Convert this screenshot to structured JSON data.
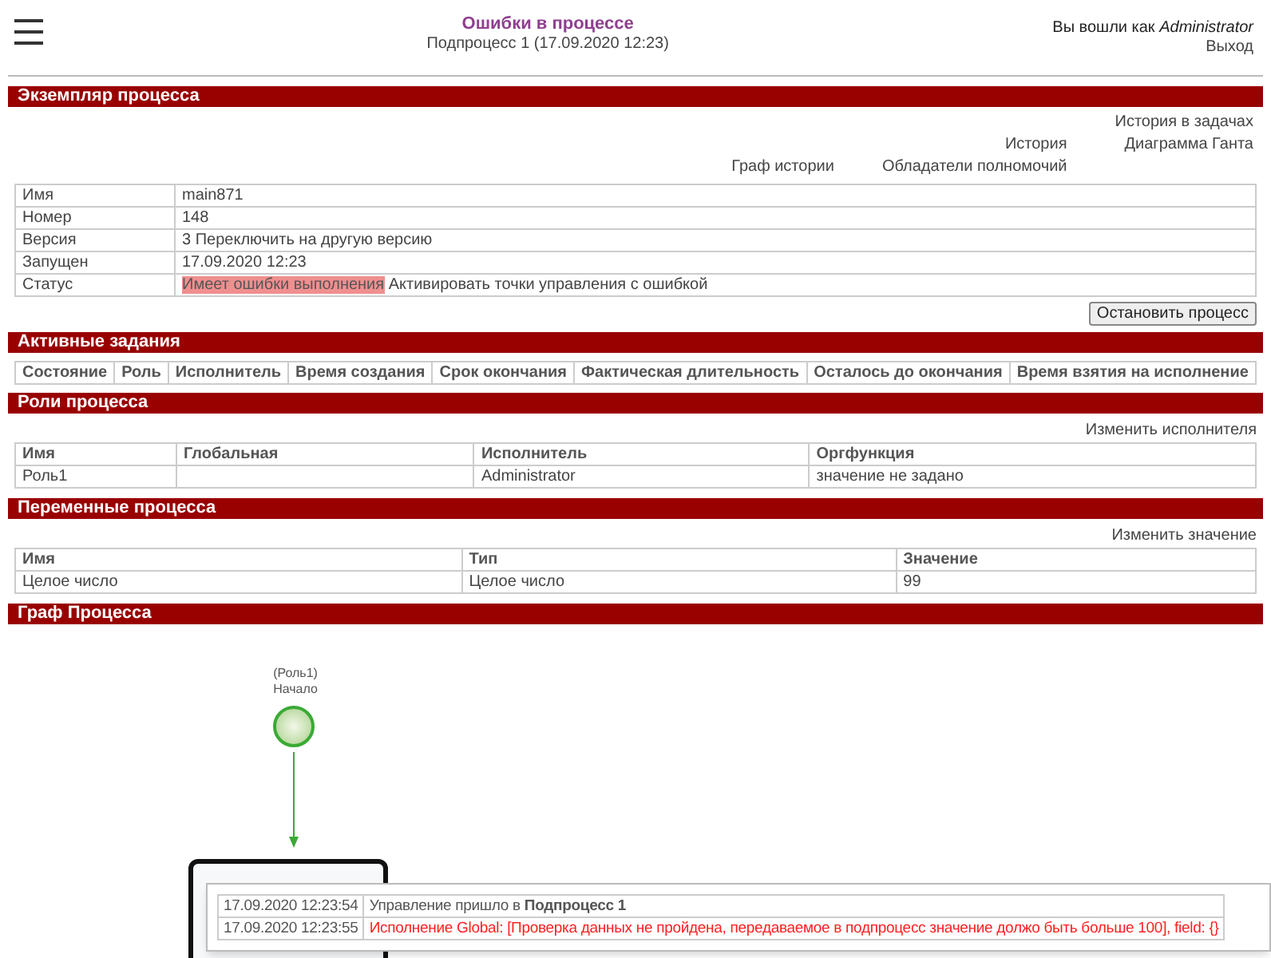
{
  "header": {
    "title": "Ошибки в процессе",
    "subtitle": "Подпроцесс 1 (17.09.2020 12:23)",
    "user_prefix": "Вы вошли как",
    "user": "Administrator",
    "logout": "Выход"
  },
  "instance": {
    "title": "Экземпляр процесса",
    "link_columns": [
      [
        "Граф истории"
      ],
      [
        "История",
        "Обладатели полномочий"
      ],
      [
        "История в задачах",
        "Диаграмма Ганта"
      ]
    ],
    "rows": [
      {
        "label": "Имя",
        "value": "main871"
      },
      {
        "label": "Номер",
        "value": "148"
      },
      {
        "label": "Версия",
        "value": "3 Переключить на другую версию"
      },
      {
        "label": "Запущен",
        "value": "17.09.2020 12:23"
      }
    ],
    "status": {
      "label": "Статус",
      "badge": "Имеет ошибки выполнения",
      "action": "Активировать точки управления с ошибкой"
    },
    "stop_button": "Остановить процесс"
  },
  "tasks": {
    "title": "Активные задания",
    "columns": [
      "Состояние",
      "Роль",
      "Исполнитель",
      "Время создания",
      "Срок окончания",
      "Фактическая длительность",
      "Осталось до окончания",
      "Время взятия на исполнение"
    ]
  },
  "roles": {
    "title": "Роли процесса",
    "action": "Изменить исполнителя",
    "columns": [
      "Имя",
      "Глобальная",
      "Исполнитель",
      "Оргфункция"
    ],
    "rows": [
      [
        "Роль1",
        "",
        "Administrator",
        "значение не задано"
      ]
    ]
  },
  "variables": {
    "title": "Переменные процесса",
    "action": "Изменить значение",
    "columns": [
      "Имя",
      "Тип",
      "Значение"
    ],
    "rows": [
      [
        "Целое число",
        "Целое число",
        "99"
      ]
    ]
  },
  "graph": {
    "title": "Граф Процесса",
    "start": {
      "role": "(Роль1)",
      "label": "Начало"
    },
    "log": [
      {
        "time": "17.09.2020 12:23:54",
        "text": "Управление пришло в **Подпроцесс 1**",
        "kind": "info"
      },
      {
        "time": "17.09.2020 12:23:55",
        "text": "Исполнение Global: [Проверка данных не пройдена, передаваемое в подпроцесс значение должо быть больше 100], field: {}",
        "kind": "error"
      }
    ]
  }
}
